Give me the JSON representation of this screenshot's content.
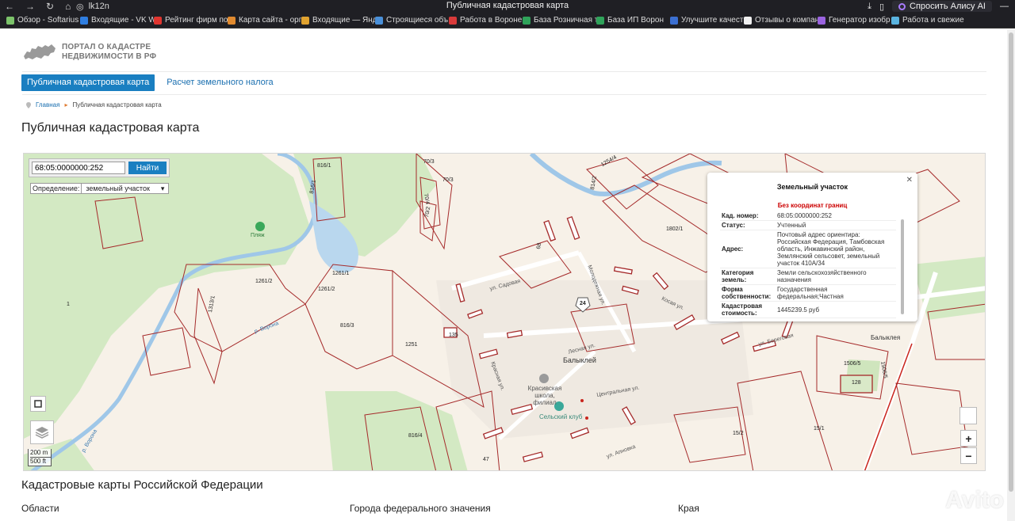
{
  "browser": {
    "url": "lk12n",
    "tab_title": "Публичная кадастровая карта",
    "alice_label": "Спросить Алису AI",
    "bookmarks": [
      {
        "label": "Обзор - Softarius",
        "color": "#7cc36a"
      },
      {
        "label": "Входящие - VK W",
        "color": "#2f7ee0"
      },
      {
        "label": "Рейтинг фирм по",
        "color": "#e0352f"
      },
      {
        "label": "Карта сайта - орг",
        "color": "#e08a2f"
      },
      {
        "label": "Входящие — Янд",
        "color": "#e0a22f"
      },
      {
        "label": "Строящиеся объ",
        "color": "#4a90d9"
      },
      {
        "label": "Работа в Вороне",
        "color": "#d93a3a"
      },
      {
        "label": "База Розничная т",
        "color": "#2fa35a"
      },
      {
        "label": "База ИП Ворон",
        "color": "#2fa35a"
      },
      {
        "label": "Улучшите качест",
        "color": "#3b6fd1"
      },
      {
        "label": "Отзывы о компан",
        "color": "#f0f0f0"
      },
      {
        "label": "Генератор изобр",
        "color": "#9a63e0"
      },
      {
        "label": "Работа и свежие",
        "color": "#5ab4e0"
      }
    ]
  },
  "site": {
    "logo_line1": "ПОРТАЛ О КАДАСТРЕ",
    "logo_line2": "НЕДВИЖИМОСТИ В РФ",
    "tabs": [
      "Публичная кадастровая карта",
      "Расчет земельного налога"
    ],
    "breadcrumb_home": "Главная",
    "breadcrumb_current": "Публичная кадастровая карта",
    "page_title": "Публичная кадастровая карта"
  },
  "map": {
    "search_value": "68:05:0000000:252",
    "search_button": "Найти",
    "definition_label": "Определение:",
    "definition_value": "земельный участок",
    "scale_m": "200 m",
    "scale_ft": "500 ft",
    "zoom_in": "+",
    "zoom_out": "−",
    "labels": {
      "village": "Балыклей",
      "village2": "Балыклея",
      "school": "Красивская школа, филиал",
      "club": "Сельский клуб",
      "beach": "Пляж",
      "street_sadovaya": "ул. Садовая",
      "street_molodezh": "Молодежная ул.",
      "street_kosaya": "Косая ул.",
      "street_beregovaya": "ул. Береговая",
      "street_centralnaya": "Центральная ул.",
      "street_krasnaya": "Красная ул.",
      "street_lesnaya": "Лесная ул.",
      "street_apnovka": "ул. Апновка",
      "river_vorona": "р. Ворона",
      "river_vorona2": "р. Ворона",
      "route": "24",
      "parcels": [
        "816/1",
        "816/1",
        "70/3",
        "70/3",
        "70/4",
        "70/2",
        "1254/4",
        "814/2",
        "1802/1",
        "1261/2",
        "1261/1",
        "1261/2",
        "1313/1",
        "816/3",
        "1251",
        "135",
        "68",
        "1506/5",
        "1506/5",
        "128",
        "816/4",
        "15/2",
        "15/1",
        "47",
        "1"
      ]
    }
  },
  "popup": {
    "title": "Земельный участок",
    "warning": "Без координат границ",
    "rows": [
      {
        "k": "Кад. номер:",
        "v": "68:05:0000000:252"
      },
      {
        "k": "Статус:",
        "v": "Учтенный"
      },
      {
        "k": "Адрес:",
        "v": "Почтовый адрес ориентира: Российская Федерация, Тамбовская область, Инжавинский район, Землянский сельсовет, земельный участок 410А/34"
      },
      {
        "k": "Категория земель:",
        "v": "Земли сельскохозяйственного назначения"
      },
      {
        "k": "Форма собственности:",
        "v": "Государственная федеральная;Частная"
      },
      {
        "k": "Кадастровая стоимость:",
        "v": "1445239.5 руб"
      }
    ]
  },
  "footer": {
    "section_title": "Кадастровые карты Российской Федерации",
    "col1": "Области",
    "col2": "Города федерального значения",
    "col3": "Края",
    "watermark": "Avito"
  }
}
